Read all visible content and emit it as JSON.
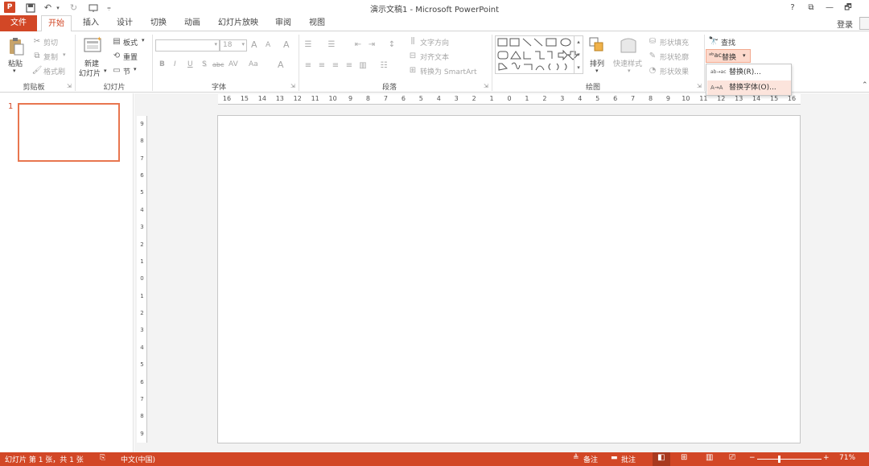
{
  "window": {
    "title": "演示文稿1 - Microsoft PowerPoint",
    "logo_letter": "P",
    "controls": [
      "?",
      "⧉",
      "—",
      "🗗"
    ],
    "login": "登录"
  },
  "tabs": {
    "file": "文件",
    "items": [
      "开始",
      "插入",
      "设计",
      "切换",
      "动画",
      "幻灯片放映",
      "审阅",
      "视图"
    ],
    "active": "开始"
  },
  "ribbon": {
    "clipboard": {
      "label": "剪贴板",
      "paste": "粘贴",
      "cut": "剪切",
      "copy": "复制",
      "format_painter": "格式刷"
    },
    "slides": {
      "label": "幻灯片",
      "new_slide_1": "新建",
      "new_slide_2": "幻灯片",
      "layout": "板式",
      "reset": "重置",
      "section": "节"
    },
    "font": {
      "label": "字体",
      "font_name": "",
      "font_size": "18",
      "grow": "A",
      "shrink": "A",
      "clear": "A",
      "bold": "B",
      "italic": "I",
      "underline": "U",
      "shadow": "S",
      "strike": "abc",
      "spacing": "AV",
      "case": "Aa",
      "color": "A"
    },
    "paragraph": {
      "label": "段落",
      "text_direction": "文字方向",
      "align_text": "对齐文本",
      "smartart": "转换为 SmartArt"
    },
    "drawing": {
      "label": "绘图",
      "arrange": "排列",
      "quick_styles": "快速样式",
      "shape_fill": "形状填充",
      "shape_outline": "形状轮廓",
      "shape_effects": "形状效果"
    },
    "editing": {
      "find": "查找",
      "replace": "替换"
    }
  },
  "replace_menu": {
    "items": [
      {
        "icon": "ab→ac",
        "label": "替换(R)..."
      },
      {
        "icon": "A→A",
        "label": "替换字体(O)..."
      }
    ]
  },
  "slides_pane": {
    "slide_number": "1"
  },
  "ruler": {
    "horizontal": [
      "16",
      "15",
      "14",
      "13",
      "12",
      "11",
      "10",
      "9",
      "8",
      "7",
      "6",
      "5",
      "4",
      "3",
      "2",
      "1",
      "0",
      "1",
      "2",
      "3",
      "4",
      "5",
      "6",
      "7",
      "8",
      "9",
      "10",
      "11",
      "12",
      "13",
      "14",
      "15",
      "16"
    ],
    "vertical": [
      "9",
      "8",
      "7",
      "6",
      "5",
      "4",
      "3",
      "2",
      "1",
      "0",
      "1",
      "2",
      "3",
      "4",
      "5",
      "6",
      "7",
      "8",
      "9"
    ]
  },
  "status": {
    "slide_info": "幻灯片 第 1 张，共 1 张",
    "language": "中文(中国)",
    "notes": "备注",
    "comments": "批注",
    "zoom": "71%",
    "zoom_level": 0.71
  },
  "colors": {
    "accent": "#d24726",
    "thumb_border": "#e8764f",
    "menu_highlight": "#fce4dc"
  }
}
